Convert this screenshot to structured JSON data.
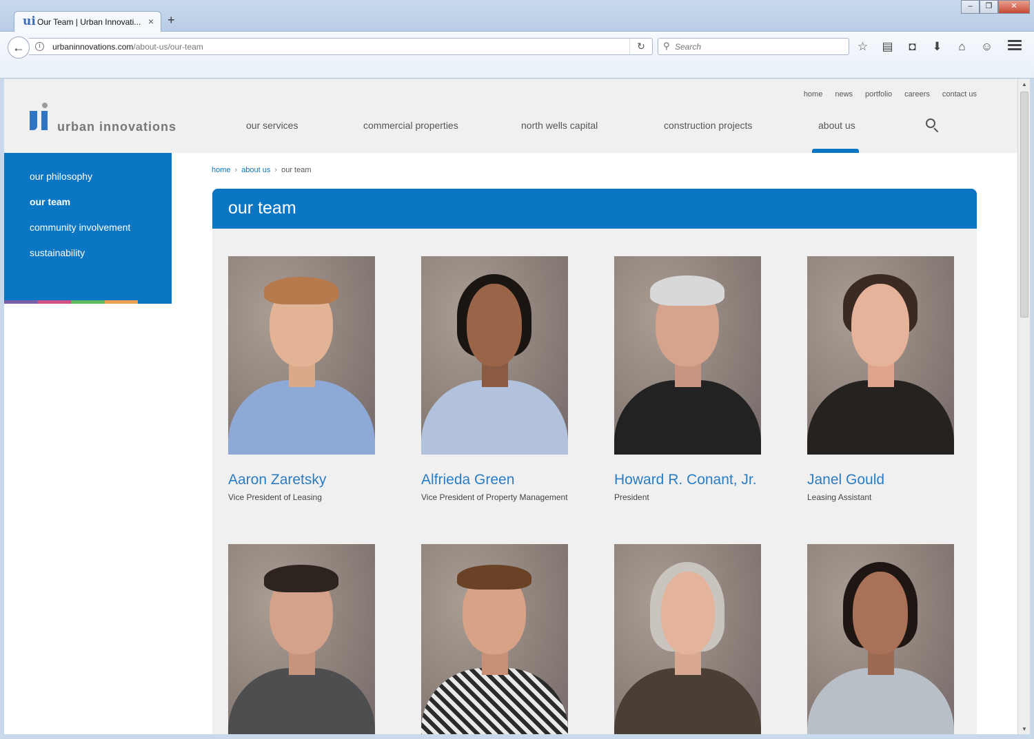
{
  "browser": {
    "tab_title": "Our Team | Urban Innovati...",
    "tab_favicon": "ui",
    "tab_close": "×",
    "new_tab": "+",
    "url_domain": "urbaninnovations.com",
    "url_path": "/about-us/our-team",
    "search_placeholder": "Search",
    "window_buttons": [
      "–",
      "❐",
      "✕"
    ],
    "toolbar_icons": [
      "star-icon",
      "reading-list-icon",
      "pocket-icon",
      "download-icon",
      "home-icon",
      "chat-icon"
    ]
  },
  "header": {
    "logo_text": "urban innovations",
    "top_links": [
      "home",
      "news",
      "portfolio",
      "careers",
      "contact us"
    ],
    "main_nav": [
      "our services",
      "commercial properties",
      "north wells capital",
      "construction projects",
      "about us"
    ],
    "active_nav": "about us"
  },
  "sidebar": {
    "items": [
      "our philosophy",
      "our team",
      "community involvement",
      "sustainability"
    ],
    "active": "our team",
    "strip_colors": [
      "#7b5fa8",
      "#d44f88",
      "#5fb85a",
      "#f0a050"
    ]
  },
  "breadcrumb": {
    "home": "home",
    "parent": "about us",
    "current": "our team",
    "separator": "›"
  },
  "page_title": "our team",
  "colors": {
    "brand_blue": "#0b76c4",
    "name_blue": "#2a7cc3"
  },
  "team": [
    {
      "name": "Aaron Zaretsky",
      "role": "Vice President of Leasing"
    },
    {
      "name": "Alfrieda Green",
      "role": "Vice President of Property Management"
    },
    {
      "name": "Howard R. Conant, Jr.",
      "role": "President"
    },
    {
      "name": "Janel Gould",
      "role": "Leasing Assistant"
    },
    {
      "name": "",
      "role": ""
    },
    {
      "name": "",
      "role": ""
    },
    {
      "name": "",
      "role": ""
    },
    {
      "name": "",
      "role": ""
    }
  ]
}
